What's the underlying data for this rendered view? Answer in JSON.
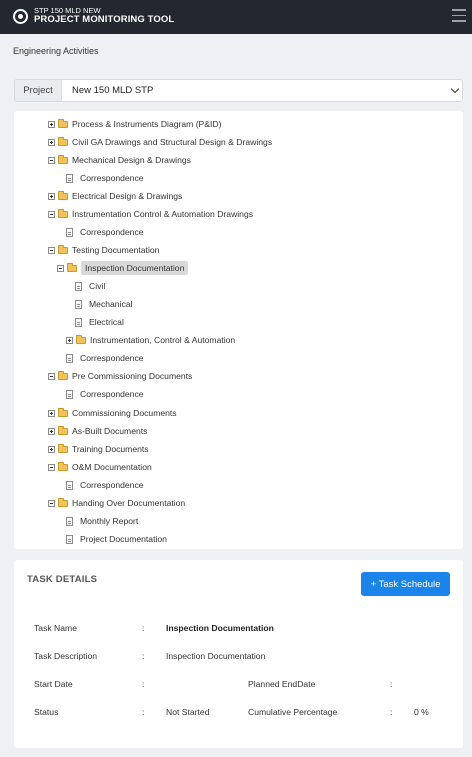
{
  "header": {
    "subtitle": "STP 150 MLD NEW",
    "title": "PROJECT MONITORING TOOL"
  },
  "page": {
    "title": "Engineering Activities"
  },
  "project": {
    "label": "Project",
    "selected": "New 150 MLD STP"
  },
  "tree": [
    {
      "label": "Process & Instruments Diagram (P&ID)",
      "type": "folder",
      "state": "collapsed"
    },
    {
      "label": "Civil GA Drawings and Structural Design & Drawings",
      "type": "folder",
      "state": "collapsed"
    },
    {
      "label": "Mechanical Design & Drawings",
      "type": "folder",
      "state": "expanded"
    },
    {
      "label": "Correspondence",
      "type": "file"
    },
    {
      "label": "Electrical Design & Drawings",
      "type": "folder",
      "state": "collapsed"
    },
    {
      "label": "Instrumentation Control & Automation Drawings",
      "type": "folder",
      "state": "expanded"
    },
    {
      "label": "Correspondence",
      "type": "file"
    },
    {
      "label": "Testing Documentation",
      "type": "folder",
      "state": "expanded"
    },
    {
      "label": "Inspection Documentation",
      "type": "folder",
      "state": "expanded",
      "selected": true
    },
    {
      "label": "Civil",
      "type": "file"
    },
    {
      "label": "Mechanical",
      "type": "file"
    },
    {
      "label": "Electrical",
      "type": "file"
    },
    {
      "label": "Instrumentation, Control & Automation",
      "type": "folder",
      "state": "collapsed"
    },
    {
      "label": "Correspondence",
      "type": "file"
    },
    {
      "label": "Pre Commissioning Documents",
      "type": "folder",
      "state": "expanded"
    },
    {
      "label": "Correspondence",
      "type": "file"
    },
    {
      "label": "Commissioning Documents",
      "type": "folder",
      "state": "collapsed"
    },
    {
      "label": "As-Built Documents",
      "type": "folder",
      "state": "collapsed"
    },
    {
      "label": "Training Documents",
      "type": "folder",
      "state": "collapsed"
    },
    {
      "label": "O&M Documentation",
      "type": "folder",
      "state": "expanded"
    },
    {
      "label": "Correspondence",
      "type": "file"
    },
    {
      "label": "Handing Over Documentation",
      "type": "folder",
      "state": "expanded"
    },
    {
      "label": "Monthly Report",
      "type": "file"
    },
    {
      "label": "Project Documentation",
      "type": "file"
    }
  ],
  "task": {
    "heading": "TASK DETAILS",
    "button_label": "+ Task Schedule",
    "separator": ":",
    "name_label": "Task Name",
    "name_value": "Inspection Documentation",
    "description_label": "Task Description",
    "description_value": "Inspection Documentation",
    "start_date_label": "Start Date",
    "start_date_value": "",
    "planned_end_label": "Planned EndDate",
    "planned_end_value": "",
    "status_label": "Status",
    "status_value": "Not Started",
    "cumulative_label": "Cumulative Percentage",
    "cumulative_value": "0 %"
  },
  "colors": {
    "topbar": "#23272f",
    "accent": "#1a84e8",
    "folder": "#f3c35a"
  }
}
